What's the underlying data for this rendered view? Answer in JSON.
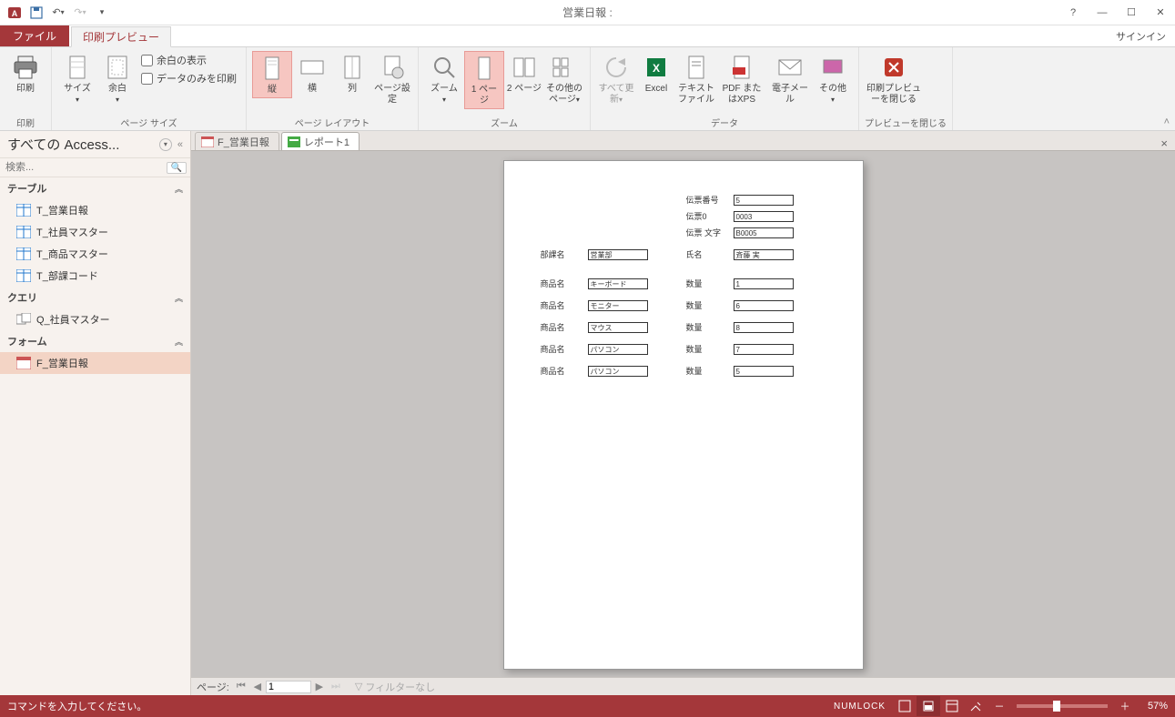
{
  "titlebar": {
    "app_title": "営業日報 :",
    "help_tip": "?",
    "signin": "サインイン"
  },
  "tabs": {
    "file": "ファイル",
    "print_preview": "印刷プレビュー"
  },
  "ribbon": {
    "print": {
      "label": "印刷",
      "group": "印刷"
    },
    "size": "サイズ",
    "margin": "余白",
    "show_margin": "余白の表示",
    "data_only": "データのみを印刷",
    "page_size_group": "ページ サイズ",
    "portrait": "縦",
    "landscape": "横",
    "columns": "列",
    "page_setup": "ページ設定",
    "page_layout_group": "ページ レイアウト",
    "zoom": "ズーム",
    "one_page": "1 ページ",
    "two_pages": "2 ページ",
    "more_pages": "その他のページ",
    "zoom_group": "ズーム",
    "refresh_all": "すべて更新",
    "excel": "Excel",
    "text_file": "テキストファイル",
    "pdf_xps": "PDF またはXPS",
    "email": "電子メール",
    "other": "その他",
    "data_group": "データ",
    "close_preview": "印刷プレビューを閉じる",
    "close_group": "プレビューを閉じる"
  },
  "nav": {
    "header": "すべての Access...",
    "search_placeholder": "検索...",
    "cat_tables": "テーブル",
    "cat_queries": "クエリ",
    "cat_forms": "フォーム",
    "items": {
      "t1": "T_営業日報",
      "t2": "T_社員マスター",
      "t3": "T_商品マスター",
      "t4": "T_部課コード",
      "q1": "Q_社員マスター",
      "f1": "F_営業日報"
    }
  },
  "doctabs": {
    "tab1": "F_営業日報",
    "tab2": "レポート1"
  },
  "report": {
    "h_denpyo_no": "伝票番号",
    "v_denpyo_no": "5",
    "h_denpyo0": "伝票0",
    "v_denpyo0": "0003",
    "h_denpyo_moji": "伝票 文字",
    "v_denpyo_moji": "B0005",
    "h_bukamei": "部課名",
    "v_bukamei": "営業部",
    "h_shimei": "氏名",
    "v_shimei": "斉藤 実",
    "h_shouhinmei": "商品名",
    "h_suuryou": "数量",
    "rows": [
      {
        "name": "キーボード",
        "qty": "1"
      },
      {
        "name": "モニター",
        "qty": "6"
      },
      {
        "name": "マウス",
        "qty": "8"
      },
      {
        "name": "パソコン",
        "qty": "7"
      },
      {
        "name": "パソコン",
        "qty": "5"
      }
    ]
  },
  "recbar": {
    "label": "ページ:",
    "value": "1",
    "filter": "フィルターなし"
  },
  "status": {
    "msg": "コマンドを入力してください。",
    "numlock": "NUMLOCK",
    "zoom": "57%"
  }
}
